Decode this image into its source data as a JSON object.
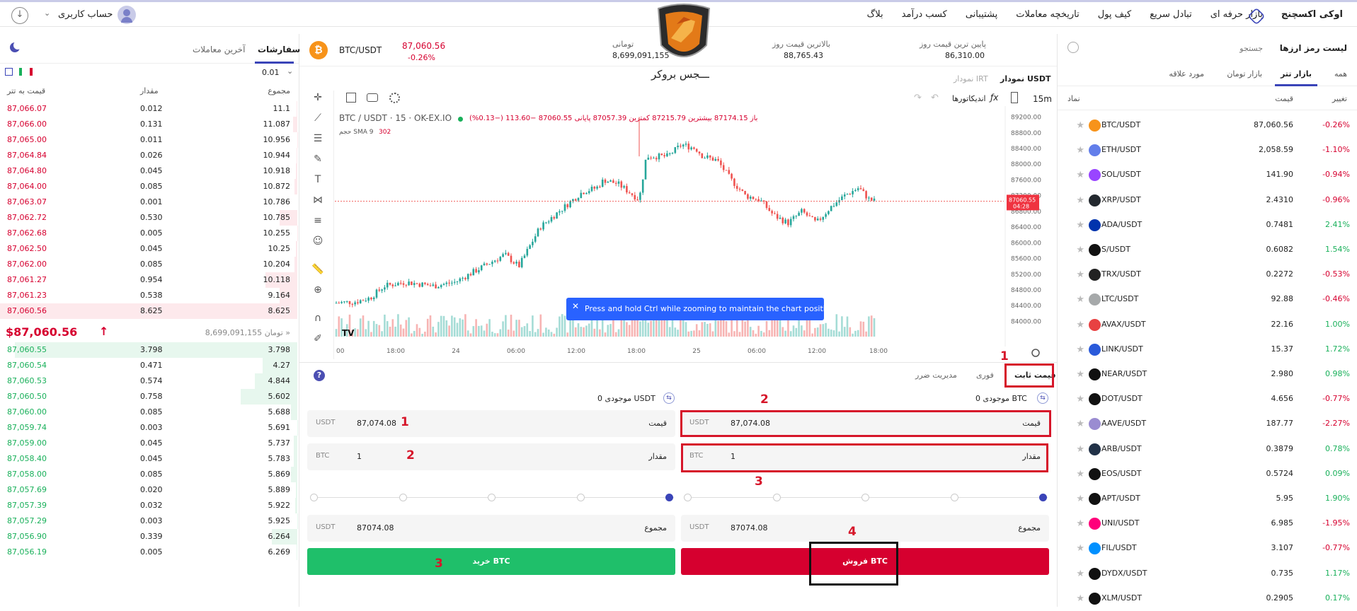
{
  "header": {
    "brand": "اوکی اکسچنج",
    "nav": [
      "بازار حرفه ای",
      "تبادل سریع",
      "کیف پول",
      "تاریخچه معاملات",
      "پشتیبانی",
      "کسب درآمد",
      "بلاگ"
    ],
    "account": "حساب کاربری"
  },
  "ticker": {
    "pair": "BTC/USDT",
    "price": "87,060.56",
    "change": "-0.26%",
    "toman_label": "تومانی",
    "toman_value": "8,699,091,155",
    "high_label": "بالاترین قیمت روز",
    "high_value": "88,765.43",
    "low_label": "پایین ترین قیمت روز",
    "low_value": "86,310.00"
  },
  "watermark": "ـــجس بروکر",
  "orderbook": {
    "tab_orders": "سفارشات",
    "tab_trades": "آخرین معاملات",
    "precision": "0.01",
    "col_total": "مجموع",
    "col_amount": "مقدار",
    "col_price": "قیمت به تتر",
    "asks": [
      [
        "87,066.07",
        "0.012",
        "11.1"
      ],
      [
        "87,066.00",
        "0.131",
        "11.087"
      ],
      [
        "87,065.00",
        "0.011",
        "10.956"
      ],
      [
        "87,064.84",
        "0.026",
        "10.944"
      ],
      [
        "87,064.80",
        "0.045",
        "10.918"
      ],
      [
        "87,064.00",
        "0.085",
        "10.872"
      ],
      [
        "87,063.07",
        "0.001",
        "10.786"
      ],
      [
        "87,062.72",
        "0.530",
        "10.785"
      ],
      [
        "87,062.68",
        "0.005",
        "10.255"
      ],
      [
        "87,062.50",
        "0.045",
        "10.25"
      ],
      [
        "87,062.00",
        "0.085",
        "10.204"
      ],
      [
        "87,061.27",
        "0.954",
        "10.118"
      ],
      [
        "87,061.23",
        "0.538",
        "9.164"
      ],
      [
        "87,060.56",
        "8.625",
        "8.625"
      ]
    ],
    "last_price": "$87,060.56",
    "last_toman": "8,699,091,155 تومان »",
    "bids": [
      [
        "87,060.55",
        "3.798",
        "3.798"
      ],
      [
        "87,060.54",
        "0.471",
        "4.27"
      ],
      [
        "87,060.53",
        "0.574",
        "4.844"
      ],
      [
        "87,060.50",
        "0.758",
        "5.602"
      ],
      [
        "87,060.00",
        "0.085",
        "5.688"
      ],
      [
        "87,059.74",
        "0.003",
        "5.691"
      ],
      [
        "87,059.00",
        "0.045",
        "5.737"
      ],
      [
        "87,058.40",
        "0.045",
        "5.783"
      ],
      [
        "87,058.00",
        "0.085",
        "5.869"
      ],
      [
        "87,057.69",
        "0.020",
        "5.889"
      ],
      [
        "87,057.39",
        "0.032",
        "5.922"
      ],
      [
        "87,057.29",
        "0.003",
        "5.925"
      ],
      [
        "87,056.90",
        "0.339",
        "6.264"
      ],
      [
        "87,056.19",
        "0.005",
        "6.269"
      ]
    ]
  },
  "chart": {
    "tab_usdt": "نمودار USDT",
    "tab_irt": "نمودار IRT",
    "interval": "15m",
    "indicators": "اندیکاتورها",
    "title": "BTC / USDT · 15 · OK-EX.IO",
    "ohlc": "باز 87174.15 بیشترین 87215.79 کمترین 87057.39 پایانی 87060.55 −113.60 (−0.13%)",
    "volume_label": "حجم SMA 9",
    "volume_value": "302",
    "price_tag": "87060.55",
    "price_tag_time": "04:28",
    "toast": "Press and hold Ctrl while zooming to maintain the chart position",
    "y_ticks": [
      "89200.00",
      "88800.00",
      "88400.00",
      "88000.00",
      "87600.00",
      "87200.00",
      "86800.00",
      "86400.00",
      "86000.00",
      "85600.00",
      "85200.00",
      "84800.00",
      "84400.00",
      "84000.00"
    ],
    "x_ticks": [
      "00",
      "18:00",
      "24",
      "06:00",
      "12:00",
      "18:00",
      "25",
      "06:00",
      "12:00",
      "18:00"
    ],
    "tv_logo": "TV"
  },
  "trade": {
    "tab_fixed": "قیمت ثابت",
    "tab_instant": "فوری",
    "tab_stop": "مدیریت ضرر",
    "sell_balance": "موجودی 0 BTC",
    "buy_balance": "موجودی 0 USDT",
    "price_label": "قیمت",
    "amount_label": "مقدار",
    "total_label": "مجموع",
    "sell_price": "87,074.08",
    "sell_amount": "1",
    "sell_total": "87074.08",
    "buy_price": "87,074.08",
    "buy_amount": "1",
    "buy_total": "87074.08",
    "unit_usdt": "USDT",
    "unit_btc": "BTC",
    "sell_button": "فروش BTC",
    "buy_button": "خرید BTC"
  },
  "annotations": {
    "n1a": "1",
    "n2a": "2",
    "n3a": "3",
    "n4": "4",
    "n1b": "1",
    "n2b": "2",
    "n3b": "3"
  },
  "markets": {
    "title": "لیست رمز ارزها",
    "search_placeholder": "جستجو",
    "tabs": [
      "همه",
      "بازار تتر",
      "بازار تومان",
      "مورد علاقه"
    ],
    "col_symbol": "نماد",
    "col_price": "قیمت",
    "col_change": "تغییر",
    "rows": [
      {
        "sym": "BTC/USDT",
        "price": "87,060.56",
        "chg": "-0.26%",
        "up": false,
        "color": "#f7931a"
      },
      {
        "sym": "ETH/USDT",
        "price": "2,058.59",
        "chg": "-1.10%",
        "up": false,
        "color": "#627eea"
      },
      {
        "sym": "SOL/USDT",
        "price": "141.90",
        "chg": "-0.94%",
        "up": false,
        "color": "#9945ff"
      },
      {
        "sym": "XRP/USDT",
        "price": "2.4310",
        "chg": "-0.96%",
        "up": false,
        "color": "#23292f"
      },
      {
        "sym": "ADA/USDT",
        "price": "0.7481",
        "chg": "2.41%",
        "up": true,
        "color": "#0033ad"
      },
      {
        "sym": "S/USDT",
        "price": "0.6082",
        "chg": "1.54%",
        "up": true,
        "color": "#111111"
      },
      {
        "sym": "TRX/USDT",
        "price": "0.2272",
        "chg": "-0.53%",
        "up": false,
        "color": "#222222"
      },
      {
        "sym": "LTC/USDT",
        "price": "92.88",
        "chg": "-0.46%",
        "up": false,
        "color": "#a6a9aa"
      },
      {
        "sym": "AVAX/USDT",
        "price": "22.16",
        "chg": "1.00%",
        "up": true,
        "color": "#e84142"
      },
      {
        "sym": "LINK/USDT",
        "price": "15.37",
        "chg": "1.72%",
        "up": true,
        "color": "#2a5ada"
      },
      {
        "sym": "NEAR/USDT",
        "price": "2.980",
        "chg": "0.98%",
        "up": true,
        "color": "#111111"
      },
      {
        "sym": "DOT/USDT",
        "price": "4.656",
        "chg": "-0.77%",
        "up": false,
        "color": "#111111"
      },
      {
        "sym": "AAVE/USDT",
        "price": "187.77",
        "chg": "-2.27%",
        "up": false,
        "color": "#9a8cd1"
      },
      {
        "sym": "ARB/USDT",
        "price": "0.3879",
        "chg": "0.78%",
        "up": true,
        "color": "#213147"
      },
      {
        "sym": "EOS/USDT",
        "price": "0.5724",
        "chg": "0.09%",
        "up": true,
        "color": "#111111"
      },
      {
        "sym": "APT/USDT",
        "price": "5.95",
        "chg": "1.90%",
        "up": true,
        "color": "#111111"
      },
      {
        "sym": "UNI/USDT",
        "price": "6.985",
        "chg": "-1.95%",
        "up": false,
        "color": "#ff007a"
      },
      {
        "sym": "FIL/USDT",
        "price": "3.107",
        "chg": "-0.77%",
        "up": false,
        "color": "#0090ff"
      },
      {
        "sym": "DYDX/USDT",
        "price": "0.735",
        "chg": "1.17%",
        "up": true,
        "color": "#111111"
      },
      {
        "sym": "XLM/USDT",
        "price": "0.2905",
        "chg": "0.17%",
        "up": true,
        "color": "#111111"
      }
    ]
  }
}
